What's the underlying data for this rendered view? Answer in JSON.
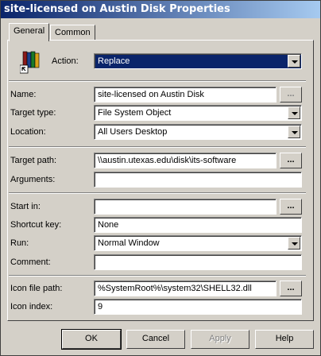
{
  "window": {
    "title": "site-licensed on Austin Disk Properties"
  },
  "tabs": [
    {
      "label": "General",
      "active": true
    },
    {
      "label": "Common",
      "active": false
    }
  ],
  "action": {
    "label": "Action:",
    "value": "Replace"
  },
  "name": {
    "label": "Name:",
    "value": "site-licensed on Austin Disk",
    "browse_label": "..."
  },
  "target_type": {
    "label": "Target type:",
    "value": "File System Object"
  },
  "location": {
    "label": "Location:",
    "value": "All Users Desktop"
  },
  "target_path": {
    "label": "Target path:",
    "value": "\\\\austin.utexas.edu\\disk\\its-software",
    "browse_label": "..."
  },
  "arguments": {
    "label": "Arguments:",
    "value": ""
  },
  "start_in": {
    "label": "Start in:",
    "value": "",
    "browse_label": "..."
  },
  "shortcut_key": {
    "label": "Shortcut key:",
    "value": "None"
  },
  "run": {
    "label": "Run:",
    "value": "Normal Window"
  },
  "comment": {
    "label": "Comment:",
    "value": ""
  },
  "icon_file_path": {
    "label": "Icon file path:",
    "value": "%SystemRoot%\\system32\\SHELL32.dll",
    "browse_label": "..."
  },
  "icon_index": {
    "label": "Icon index:",
    "value": "9"
  },
  "buttons": {
    "ok": "OK",
    "cancel": "Cancel",
    "apply": "Apply",
    "help": "Help"
  },
  "icons": {
    "shortcut": "shortcut-books-icon",
    "dropdown": "chevron-down-icon"
  }
}
